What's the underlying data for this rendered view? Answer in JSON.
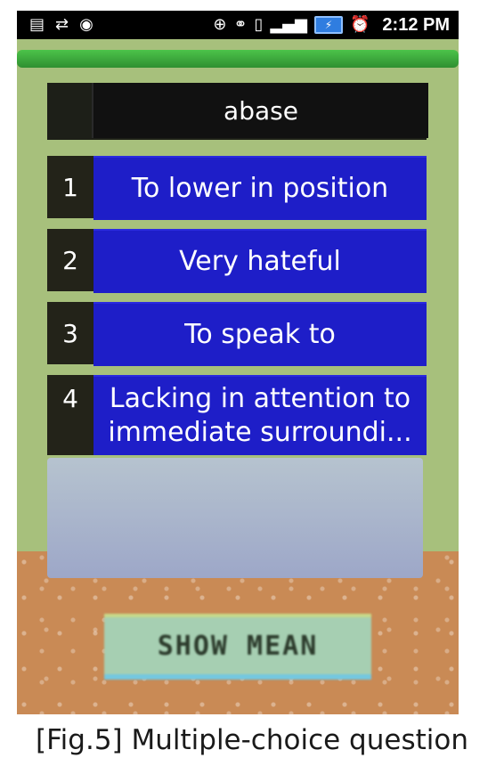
{
  "status_bar": {
    "time": "2:12 PM",
    "left_icons": [
      "bag-icon",
      "usb-icon",
      "android-debug-icon"
    ],
    "right_icons": [
      "gps-icon",
      "wifi-icon",
      "vibrate-icon",
      "signal-icon",
      "battery-charging-icon",
      "alarm-icon"
    ]
  },
  "quiz": {
    "word": "abase",
    "options": [
      {
        "number": "1",
        "label": "To lower in position"
      },
      {
        "number": "2",
        "label": "Very hateful"
      },
      {
        "number": "3",
        "label": "To speak to"
      },
      {
        "number": "4",
        "label": "Lacking in attention to immediate surroundi..."
      }
    ],
    "show_mean_label": "SHOW MEAN"
  },
  "caption": "[Fig.5] Multiple-choice question",
  "colors": {
    "option_bg": "#1e1ec8",
    "app_bg": "#a7c07c",
    "ground": "#c98a55"
  }
}
